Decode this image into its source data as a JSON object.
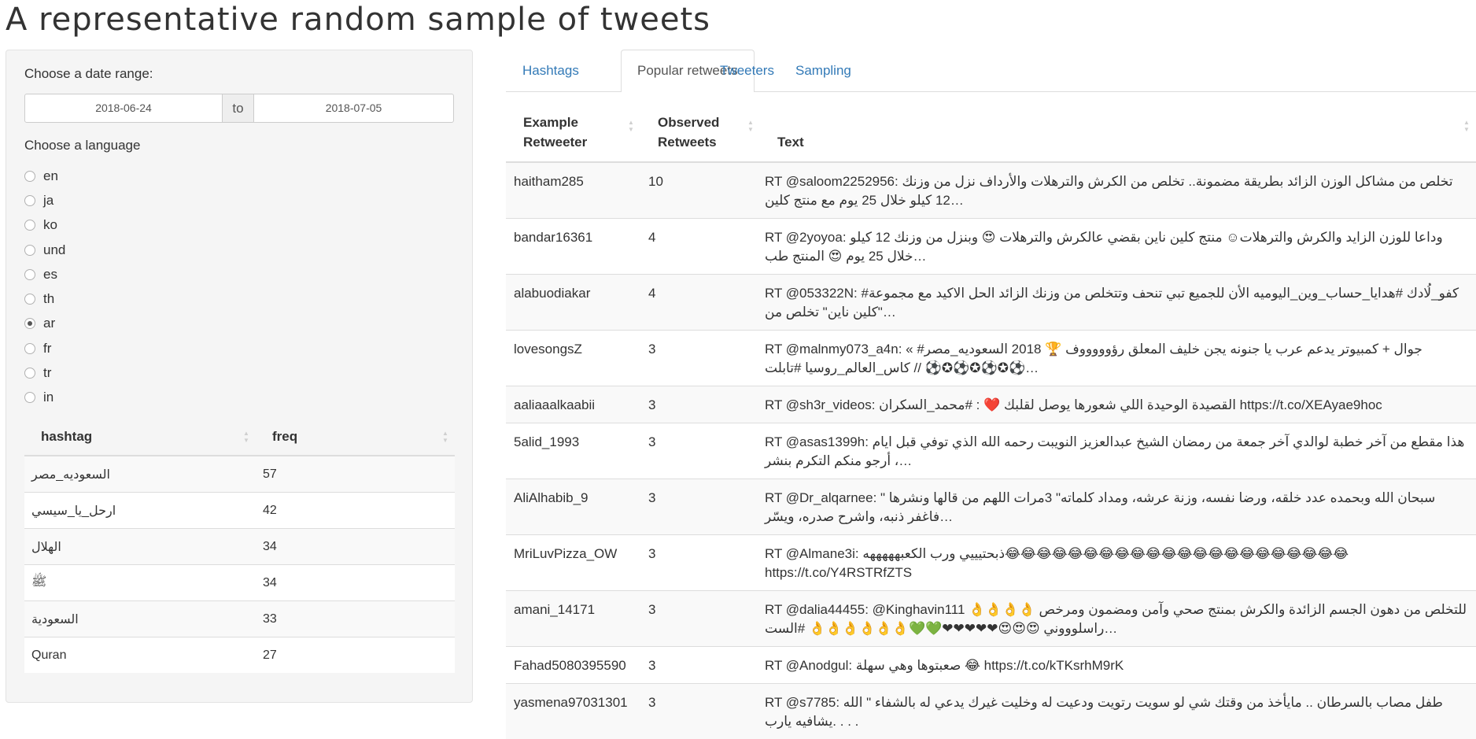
{
  "page": {
    "title": "A representative random sample of tweets"
  },
  "sidebar": {
    "date_range_label": "Choose a date range:",
    "date_start": "2018-06-24",
    "date_separator": "to",
    "date_end": "2018-07-05",
    "language_label": "Choose a language",
    "languages": [
      {
        "code": "en",
        "selected": false
      },
      {
        "code": "ja",
        "selected": false
      },
      {
        "code": "ko",
        "selected": false
      },
      {
        "code": "und",
        "selected": false
      },
      {
        "code": "es",
        "selected": false
      },
      {
        "code": "th",
        "selected": false
      },
      {
        "code": "ar",
        "selected": true
      },
      {
        "code": "fr",
        "selected": false
      },
      {
        "code": "tr",
        "selected": false
      },
      {
        "code": "in",
        "selected": false
      }
    ],
    "hashtag_table": {
      "headers": [
        "hashtag",
        "freq"
      ],
      "rows": [
        [
          "السعوديه_مصر",
          "57"
        ],
        [
          "ارحل_يا_سيسي",
          "42"
        ],
        [
          "الهلال",
          "34"
        ],
        [
          "ﷺ",
          "34"
        ],
        [
          "السعودية",
          "33"
        ],
        [
          "Quran",
          "27"
        ]
      ]
    }
  },
  "tabs": [
    {
      "label": "Hashtags",
      "active": false
    },
    {
      "label": "Popular retweets",
      "active": true
    },
    {
      "label": "Tweeters",
      "active": false
    },
    {
      "label": "Sampling",
      "active": false
    }
  ],
  "retweets_table": {
    "headers": [
      "Example Retweeter",
      "Observed Retweets",
      "Text"
    ],
    "rows": [
      [
        "haitham285",
        "10",
        "RT @saloom2252956: تخلص من مشاكل الوزن الزائد بطريقة مضمونة.. تخلص من الكرش والترهلات والأرداف نزل من وزنك 12 كيلو خلال 25 يوم مع منتج كلين…"
      ],
      [
        "bandar16361",
        "4",
        "RT @2yoyoa: وداعا للوزن الزايد والكرش والترهلات☺ منتج كلين ناين بقضي عالكرش والترهلات 😍 وبنزل من وزنك 12 كيلو خلال 25 يوم 😍 المنتج طب…"
      ],
      [
        "alabuodiakar",
        "4",
        "RT @053322N: #كفو_لُادك #هدايا_حساب_وين_اليوميه الأن للجميع تبي تنحف وتتخلص من وزنك الزائد الحل الاكيد مع مجموعة \"كلين ناين\" تخلص من…"
      ],
      [
        "lovesongsZ",
        "3",
        "RT @malnmy073_a4n: « #جوال + كمبيوتر يدعم عرب يا جنونه يجن خليف المعلق رؤوووووف 🏆 2018 السعوديه_مصر كاس_العالم_روسيا #تابلت // ⚽✪⚽✪⚽✪⚽…"
      ],
      [
        "aaliaaalkaabii",
        "3",
        "RT @sh3r_videos: القصيدة الوحيدة اللي شعورها يوصل لقلبك ❤️ : #محمد_السكران https://t.co/XEAyae9hoc"
      ],
      [
        "5alid_1993",
        "3",
        "RT @asas1399h: هذا مقطع من آخر خطبة لوالدي آخر جمعة من رمضان الشيخ عبدالعزيز النويبت رحمه الله الذي توفي قبل ايام ، أرجو منكم التكرم بنشر…"
      ],
      [
        "AliAlhabib_9",
        "3",
        "RT @Dr_alqarnee: \" سبحان الله وبحمده عدد خلقه، ورضا نفسه، وزنة عرشه، ومداد كلماته\" 3مرات اللهم من قالها ونشرها فاغفر ذنبه، واشرح صدره، ويسّر…"
      ],
      [
        "MriLuvPizza_OW",
        "3",
        "RT @Almane3i: ذبحتيييي ورب الكعبهههههه😂😂😂😂😂😂😂😂😂😂😂😂😂😂😂😂😂😂😂😂😂😂 https://t.co/Y4RSTRfZTS"
      ],
      [
        "amani_14171",
        "3",
        "RT @dalia44455: @Kinghavin111 👌👌👌👌 للتخلص من دهون الجسم الزائدة والكرش بمنتج صحي وآمن ومضمون ومرخص راسلوووني 😍😍😍❤❤❤❤❤💚💚👌👌👌👌👌👌 #الست…"
      ],
      [
        "Fahad5080395590",
        "3",
        "RT @Anodgul: صعبتوها وهي سهلة 😂 https://t.co/kTKsrhM9rK"
      ],
      [
        "yasmena97031301",
        "3",
        "RT @s7785: طفل مصاب بالسرطان .. مايأخذ من وقتك شي لو سويت رتويت ودعيت له وخليت غيرك يدعي له بالشفاء \" الله يشافيه يارب. . . ."
      ]
    ]
  }
}
